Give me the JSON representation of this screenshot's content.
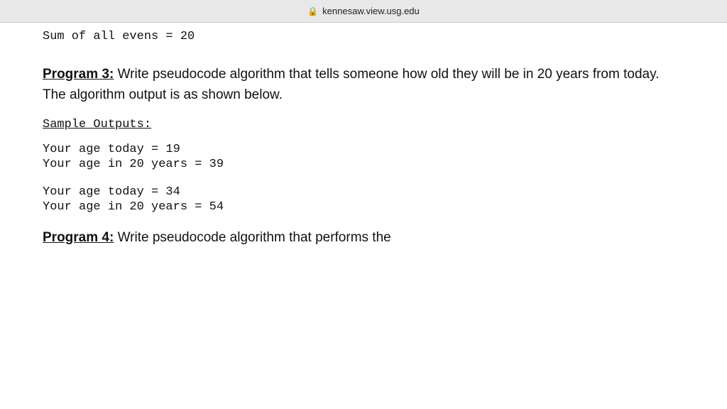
{
  "browser": {
    "url": "kennesaw.view.usg.edu",
    "lock_icon": "🔒"
  },
  "top_code_line": "Sum of all evens = 20",
  "program3": {
    "label": "Program 3:",
    "description": "Write pseudocode algorithm that tells someone how old they will be in 20 years from today. The algorithm output is as shown below.",
    "sample_outputs_label": "Sample Outputs:",
    "samples": [
      {
        "line1": "Your age today = 19",
        "line2": "Your age in 20 years = 39"
      },
      {
        "line1": "Your age today = 34",
        "line2": "Your age in 20 years = 54"
      }
    ]
  },
  "program4": {
    "label": "Program 4:",
    "description": "Write pseudocode algorithm that performs the"
  }
}
